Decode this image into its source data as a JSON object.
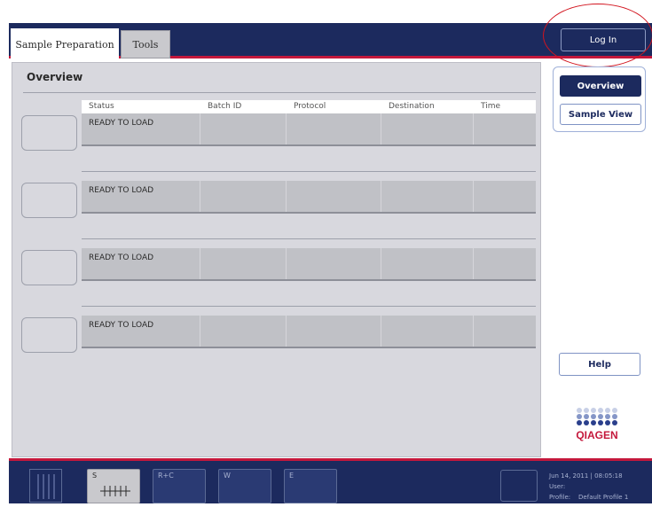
{
  "tabs": [
    {
      "label": "Sample Preparation",
      "active": true
    },
    {
      "label": "Tools",
      "active": false
    }
  ],
  "header": {
    "login_label": "Log In"
  },
  "overview": {
    "title": "Overview",
    "columns": [
      "Status",
      "Batch ID",
      "Protocol",
      "Destination",
      "Time"
    ],
    "rows": [
      {
        "status": "READY TO LOAD",
        "batch_id": "",
        "protocol": "",
        "destination": "",
        "time": ""
      },
      {
        "status": "READY TO LOAD",
        "batch_id": "",
        "protocol": "",
        "destination": "",
        "time": ""
      },
      {
        "status": "READY TO LOAD",
        "batch_id": "",
        "protocol": "",
        "destination": "",
        "time": ""
      },
      {
        "status": "READY TO LOAD",
        "batch_id": "",
        "protocol": "",
        "destination": "",
        "time": ""
      }
    ]
  },
  "side_nav": {
    "overview_label": "Overview",
    "sample_view_label": "Sample View",
    "help_label": "Help"
  },
  "logo_text": "QIAGEN",
  "bottom": {
    "drawers": [
      "S",
      "R+C",
      "W",
      "E"
    ],
    "datetime": "Jun 14, 2011 | 08:05:18",
    "user_label": "User:",
    "profile_label": "Profile:",
    "profile_value": "Default Profile 1"
  },
  "colors": {
    "navy": "#1c2a5e",
    "accent_red": "#c4183c",
    "panel_gray": "#d8d8de"
  }
}
